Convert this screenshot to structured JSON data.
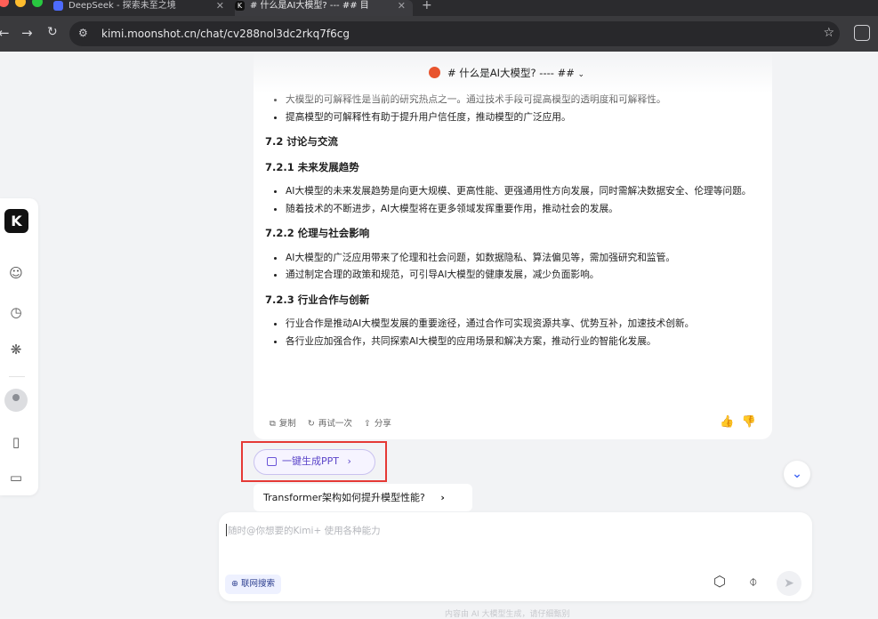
{
  "browser": {
    "tabs": [
      {
        "title": "DeepSeek - 探索未至之境",
        "active": false
      },
      {
        "title": "# 什么是AI大模型? --- ## 目",
        "active": true
      }
    ],
    "url": "kimi.moonshot.cn/chat/cv288nol3dc2rkq7f6cg"
  },
  "chat": {
    "title": "# 什么是AI大模型?  ---- ##",
    "sections": [
      {
        "type": "bullets",
        "items": [
          "大模型的可解释性是当前的研究热点之一。通过技术手段可提高模型的透明度和可解释性。",
          "提高模型的可解释性有助于提升用户信任度，推动模型的广泛应用。"
        ]
      },
      {
        "type": "heading",
        "text": "7.2 讨论与交流"
      },
      {
        "type": "heading",
        "text": "7.2.1 未来发展趋势"
      },
      {
        "type": "bullets",
        "items": [
          "AI大模型的未来发展趋势是向更大规模、更高性能、更强通用性方向发展，同时需解决数据安全、伦理等问题。",
          "随着技术的不断进步，AI大模型将在更多领域发挥重要作用，推动社会的发展。"
        ]
      },
      {
        "type": "heading",
        "text": "7.2.2 伦理与社会影响"
      },
      {
        "type": "bullets",
        "items": [
          "AI大模型的广泛应用带来了伦理和社会问题，如数据隐私、算法偏见等，需加强研究和监管。",
          "通过制定合理的政策和规范，可引导AI大模型的健康发展，减少负面影响。"
        ]
      },
      {
        "type": "heading",
        "text": "7.2.3 行业合作与创新"
      },
      {
        "type": "bullets",
        "items": [
          "行业合作是推动AI大模型发展的重要途径，通过合作可实现资源共享、优势互补，加速技术创新。",
          "各行业应加强合作，共同探索AI大模型的应用场景和解决方案，推动行业的智能化发展。"
        ]
      }
    ],
    "actions": {
      "copy": "复制",
      "retry": "再试一次",
      "share": "分享"
    },
    "ppt_button": "一键生成PPT",
    "suggestion": "Transformer架构如何提升模型性能?"
  },
  "input": {
    "placeholder": "随时@你想要的Kimi+ 使用各种能力",
    "web_search": "联网搜索"
  },
  "footer": "内容由 AI 大模型生成，请仔细甄别",
  "colors": {
    "accent": "#5b45c9",
    "highlight_box": "#e53935",
    "ppt_icon": "#e8542e"
  }
}
